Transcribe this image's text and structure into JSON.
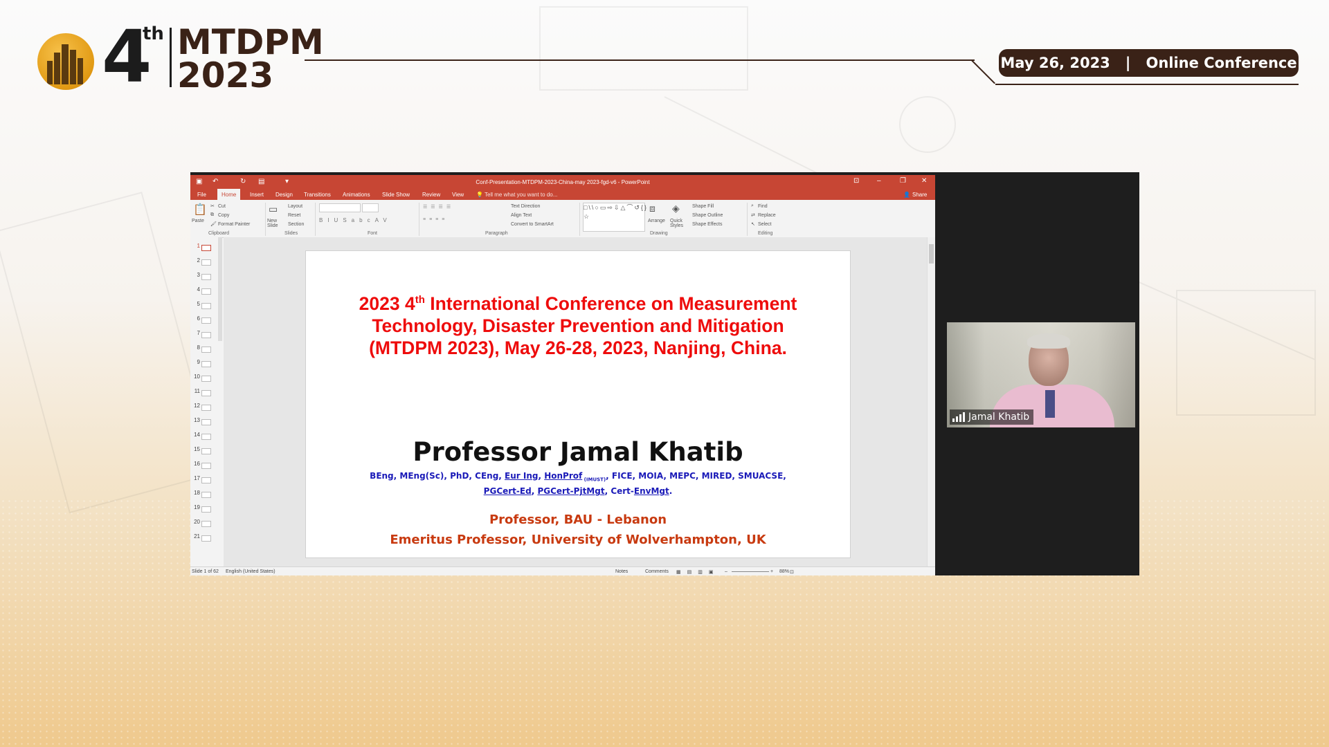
{
  "header": {
    "logo_number": "4",
    "logo_superscript": "th",
    "logo_line1": "MTDPM",
    "logo_line2": "2023",
    "date": "May 26, 2023",
    "separator": "|",
    "event_type": "Online Conference"
  },
  "powerpoint": {
    "window_title": "Conf-Presentation-MTDPM-2023-China-may 2023-fgd-v6 - PowerPoint",
    "tabs": [
      "File",
      "Home",
      "Insert",
      "Design",
      "Transitions",
      "Animations",
      "Slide Show",
      "Review",
      "View"
    ],
    "active_tab": "Home",
    "tell_me": "Tell me what you want to do...",
    "share": "Share",
    "ribbon": {
      "paste": "Paste",
      "cut": "Cut",
      "copy": "Copy",
      "format_painter": "Format Painter",
      "new_slide": "New Slide",
      "layout": "Layout",
      "reset": "Reset",
      "section": "Section",
      "text_direction": "Text Direction",
      "align_text": "Align Text",
      "convert_smartart": "Convert to SmartArt",
      "arrange": "Arrange",
      "quick_styles": "Quick Styles",
      "shape_fill": "Shape Fill",
      "shape_outline": "Shape Outline",
      "shape_effects": "Shape Effects",
      "find": "Find",
      "replace": "Replace",
      "select": "Select",
      "groups": {
        "clipboard": "Clipboard",
        "slides": "Slides",
        "font": "Font",
        "paragraph": "Paragraph",
        "drawing": "Drawing",
        "editing": "Editing"
      }
    },
    "slide_numbers": [
      "1",
      "2",
      "3",
      "4",
      "5",
      "6",
      "7",
      "8",
      "9",
      "10",
      "11",
      "12",
      "13",
      "14",
      "15",
      "16",
      "17",
      "18",
      "19",
      "20",
      "21"
    ],
    "selected_slide": "1",
    "slide": {
      "title_pre": "2023 4",
      "title_sup": "th",
      "title_rest": " International Conference on Measurement Technology, Disaster Prevention and Mitigation (MTDPM 2023), May 26-28, 2023, Nanjing, China.",
      "name": "Professor Jamal Khatib",
      "cred_line1_a": "BEng, MEng(Sc), PhD, CEng, ",
      "cred_line1_b": "Eur Ing",
      "cred_line1_c": ", ",
      "cred_line1_d": "HonProf",
      "cred_line1_sub": " (IMUST)",
      "cred_line1_e": ", FICE, MOIA, MEPC, MIRED, SMUACSE,",
      "cred_line2_a": "PGCert-Ed",
      "cred_line2_b": ", ",
      "cred_line2_c": "PGCert-PjtMgt",
      "cred_line2_d": ", Cert-",
      "cred_line2_e": "EnvMgt",
      "cred_line2_f": ".",
      "affiliation1": "Professor, BAU - Lebanon",
      "affiliation2": "Emeritus Professor, University of Wolverhampton, UK"
    },
    "status": {
      "slide_count": "Slide 1 of 62",
      "language": "English (United States)",
      "notes": "Notes",
      "comments": "Comments",
      "zoom": "88%"
    }
  },
  "video": {
    "participant_name": "Jamal Khatib"
  },
  "colors": {
    "brand_dark": "#3a2217",
    "ppt_red": "#c74634",
    "slide_title_red": "#ee0c0c",
    "credential_blue": "#1a1ab8",
    "affiliation_orange": "#c83a10"
  }
}
